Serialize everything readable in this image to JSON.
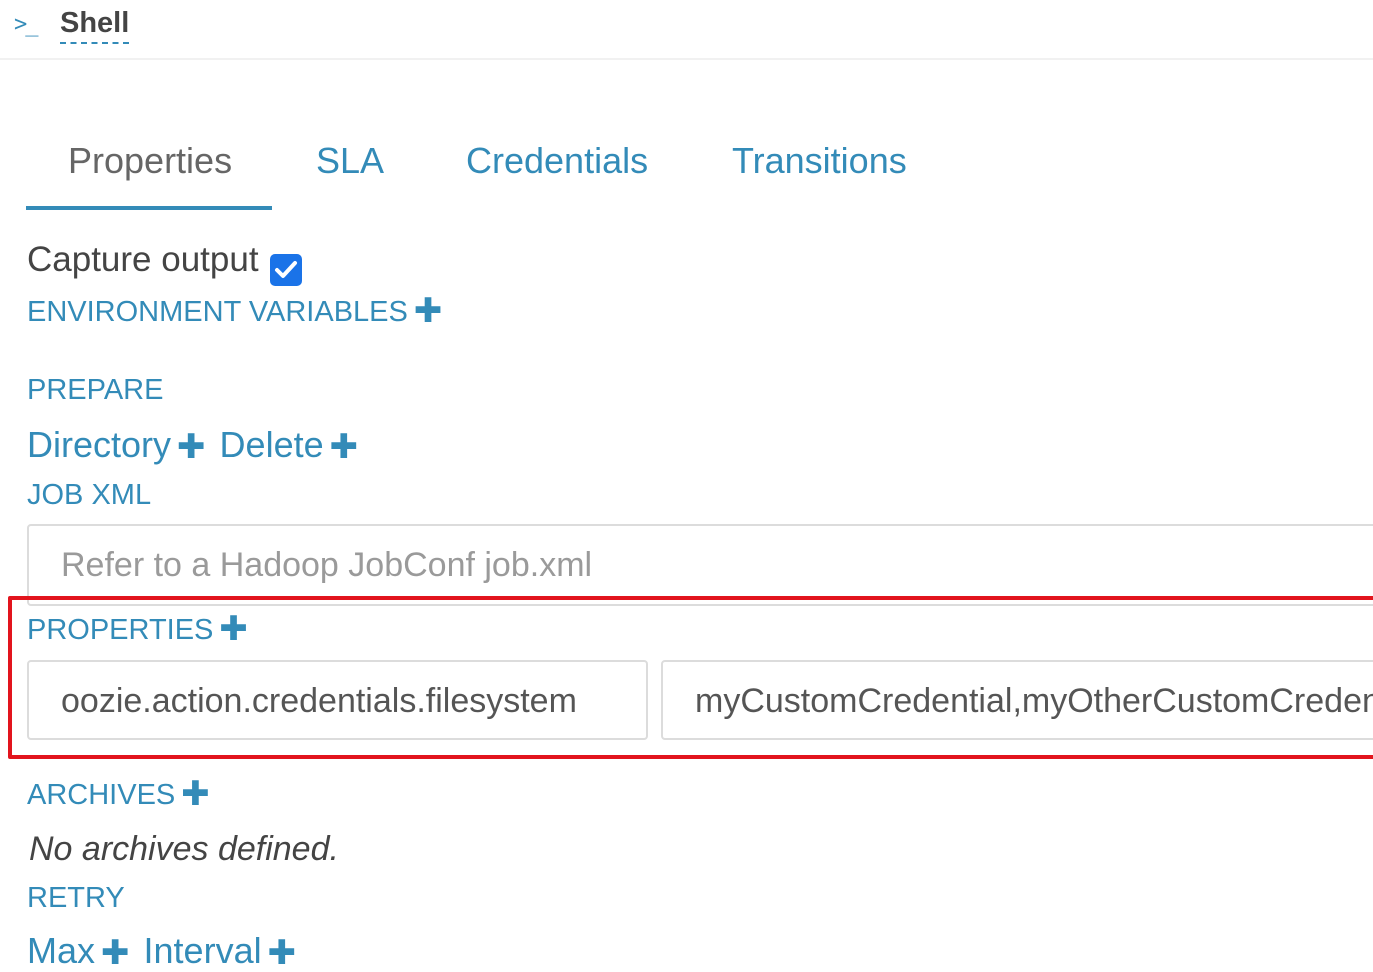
{
  "header": {
    "icon": "terminal-icon",
    "title": "Shell"
  },
  "tabs": [
    {
      "label": "Properties",
      "active": true
    },
    {
      "label": "SLA",
      "active": false
    },
    {
      "label": "Credentials",
      "active": false
    },
    {
      "label": "Transitions",
      "active": false
    }
  ],
  "capture_output": {
    "label": "Capture output",
    "checked": true
  },
  "env_vars": {
    "label": "ENVIRONMENT VARIABLES"
  },
  "prepare": {
    "label": "PREPARE",
    "directory": "Directory",
    "delete": "Delete"
  },
  "job_xml": {
    "label": "JOB XML",
    "placeholder": "Refer to a Hadoop JobConf job.xml"
  },
  "properties": {
    "label": "PROPERTIES",
    "key": "oozie.action.credentials.filesystem",
    "value": "myCustomCredential,myOtherCustomCredential"
  },
  "archives": {
    "label": "ARCHIVES",
    "empty_text": "No archives defined."
  },
  "retry": {
    "label": "RETRY",
    "max": "Max",
    "interval": "Interval"
  },
  "colors": {
    "accent": "#338bb8",
    "highlight": "#e2141d",
    "checkbox": "#1a73e8"
  }
}
